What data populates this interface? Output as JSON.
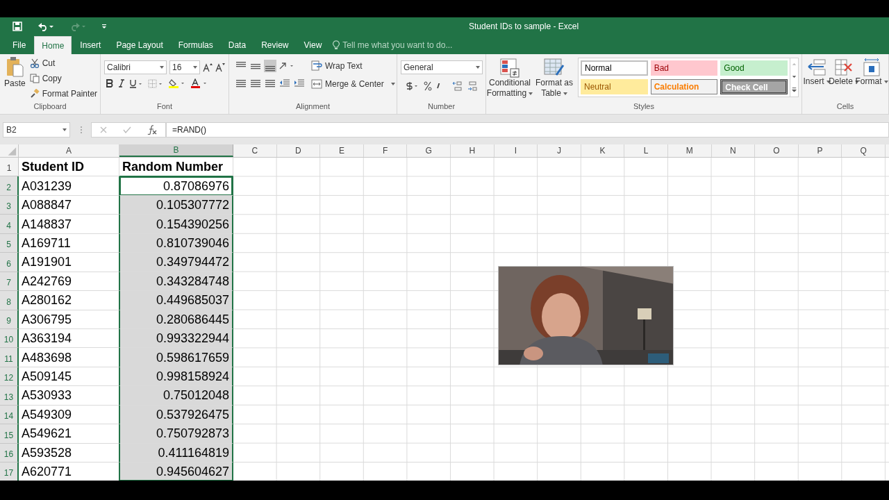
{
  "window": {
    "title": "Student IDs to sample - Excel"
  },
  "tabs": [
    {
      "label": "File",
      "selected": false
    },
    {
      "label": "Home",
      "selected": true
    },
    {
      "label": "Insert",
      "selected": false
    },
    {
      "label": "Page Layout",
      "selected": false
    },
    {
      "label": "Formulas",
      "selected": false
    },
    {
      "label": "Data",
      "selected": false
    },
    {
      "label": "Review",
      "selected": false
    },
    {
      "label": "View",
      "selected": false
    }
  ],
  "tell_me": {
    "placeholder": "Tell me what you want to do..."
  },
  "ribbon": {
    "clipboard": {
      "label": "Clipboard",
      "paste": "Paste",
      "cut": "Cut",
      "copy": "Copy",
      "format_painter": "Format Painter"
    },
    "font": {
      "label": "Font",
      "font_name": "Calibri",
      "font_size": "16"
    },
    "alignment": {
      "label": "Alignment",
      "wrap_text": "Wrap Text",
      "merge_center": "Merge & Center"
    },
    "number": {
      "label": "Number",
      "format": "General"
    },
    "styles": {
      "label": "Styles",
      "conditional_formatting": [
        "Conditional",
        "Formatting"
      ],
      "format_as_table": [
        "Format as",
        "Table"
      ],
      "cell_styles": [
        {
          "name": "Normal",
          "kind": "normal"
        },
        {
          "name": "Bad",
          "kind": "bad"
        },
        {
          "name": "Good",
          "kind": "good"
        },
        {
          "name": "Neutral",
          "kind": "neutral"
        },
        {
          "name": "Calculation",
          "kind": "calculation"
        },
        {
          "name": "Check Cell",
          "kind": "check"
        }
      ]
    },
    "cells": {
      "label": "Cells",
      "insert": "Insert",
      "delete": "Delete",
      "format": "Format"
    }
  },
  "formula_bar": {
    "name_box": "B2",
    "formula": "=RAND()"
  },
  "columns": [
    {
      "label": "A",
      "selected": false
    },
    {
      "label": "B",
      "selected": true
    },
    {
      "label": "C",
      "selected": false
    },
    {
      "label": "D",
      "selected": false
    },
    {
      "label": "E",
      "selected": false
    },
    {
      "label": "F",
      "selected": false
    },
    {
      "label": "G",
      "selected": false
    },
    {
      "label": "H",
      "selected": false
    },
    {
      "label": "I",
      "selected": false
    },
    {
      "label": "J",
      "selected": false
    },
    {
      "label": "K",
      "selected": false
    },
    {
      "label": "L",
      "selected": false
    },
    {
      "label": "M",
      "selected": false
    },
    {
      "label": "N",
      "selected": false
    },
    {
      "label": "O",
      "selected": false
    },
    {
      "label": "P",
      "selected": false
    },
    {
      "label": "Q",
      "selected": false
    }
  ],
  "rows": [
    {
      "number": "1",
      "kind": "header",
      "cells": [
        "Student ID",
        "Random Number"
      ],
      "selected": false,
      "active": false
    },
    {
      "number": "2",
      "kind": "data",
      "cells": [
        "A031239",
        "0.87086976"
      ],
      "selected": true,
      "active": true
    },
    {
      "number": "3",
      "kind": "data",
      "cells": [
        "A088847",
        "0.105307772"
      ],
      "selected": true,
      "active": false
    },
    {
      "number": "4",
      "kind": "data",
      "cells": [
        "A148837",
        "0.154390256"
      ],
      "selected": true,
      "active": false
    },
    {
      "number": "5",
      "kind": "data",
      "cells": [
        "A169711",
        "0.810739046"
      ],
      "selected": true,
      "active": false
    },
    {
      "number": "6",
      "kind": "data",
      "cells": [
        "A191901",
        "0.349794472"
      ],
      "selected": true,
      "active": false
    },
    {
      "number": "7",
      "kind": "data",
      "cells": [
        "A242769",
        "0.343284748"
      ],
      "selected": true,
      "active": false
    },
    {
      "number": "8",
      "kind": "data",
      "cells": [
        "A280162",
        "0.449685037"
      ],
      "selected": true,
      "active": false
    },
    {
      "number": "9",
      "kind": "data",
      "cells": [
        "A306795",
        "0.280686445"
      ],
      "selected": true,
      "active": false
    },
    {
      "number": "10",
      "kind": "data",
      "cells": [
        "A363194",
        "0.993322944"
      ],
      "selected": true,
      "active": false
    },
    {
      "number": "11",
      "kind": "data",
      "cells": [
        "A483698",
        "0.598617659"
      ],
      "selected": true,
      "active": false
    },
    {
      "number": "12",
      "kind": "data",
      "cells": [
        "A509145",
        "0.998158924"
      ],
      "selected": true,
      "active": false
    },
    {
      "number": "13",
      "kind": "data",
      "cells": [
        "A530933",
        "0.75012048"
      ],
      "selected": true,
      "active": false
    },
    {
      "number": "14",
      "kind": "data",
      "cells": [
        "A549309",
        "0.537926475"
      ],
      "selected": true,
      "active": false
    },
    {
      "number": "15",
      "kind": "data",
      "cells": [
        "A549621",
        "0.750792873"
      ],
      "selected": true,
      "active": false
    },
    {
      "number": "16",
      "kind": "data",
      "cells": [
        "A593528",
        "0.411164819"
      ],
      "selected": true,
      "active": false
    },
    {
      "number": "17",
      "kind": "data",
      "cells": [
        "A620771",
        "0.945604627"
      ],
      "selected": true,
      "active": false
    }
  ]
}
